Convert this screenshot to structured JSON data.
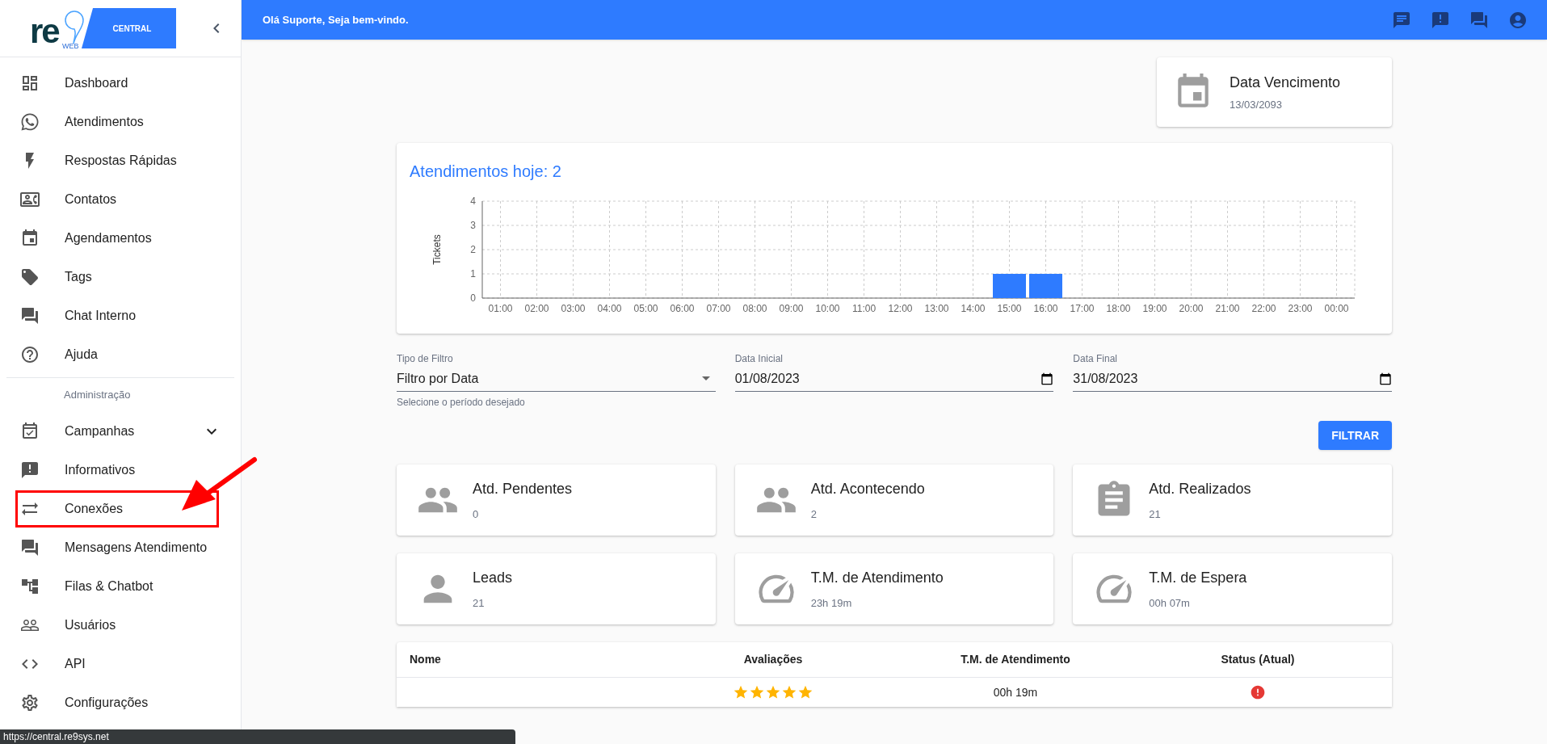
{
  "logo": {
    "text": "re",
    "sub": "WEB",
    "badge": "CENTRAL"
  },
  "sidebar": {
    "items": [
      {
        "kind": "link",
        "label": "Dashboard",
        "highlighted": false
      },
      {
        "kind": "link",
        "label": "Atendimentos",
        "highlighted": false
      },
      {
        "kind": "link",
        "label": "Respostas Rápidas",
        "highlighted": false
      },
      {
        "kind": "link",
        "label": "Contatos",
        "highlighted": false
      },
      {
        "kind": "link",
        "label": "Agendamentos",
        "highlighted": false
      },
      {
        "kind": "link",
        "label": "Tags",
        "highlighted": false
      },
      {
        "kind": "link",
        "label": "Chat Interno",
        "highlighted": false
      },
      {
        "kind": "link",
        "label": "Ajuda",
        "highlighted": false
      },
      {
        "kind": "section",
        "label": "Administração"
      },
      {
        "kind": "group",
        "label": "Campanhas",
        "expanded": false,
        "highlighted": false
      },
      {
        "kind": "link",
        "label": "Informativos",
        "highlighted": false
      },
      {
        "kind": "link",
        "label": "Conexões",
        "highlighted": true
      },
      {
        "kind": "link",
        "label": "Mensagens Atendimento",
        "highlighted": false
      },
      {
        "kind": "link",
        "label": "Filas & Chatbot",
        "highlighted": false
      },
      {
        "kind": "link",
        "label": "Usuários",
        "highlighted": false
      },
      {
        "kind": "link",
        "label": "API",
        "highlighted": false
      },
      {
        "kind": "link",
        "label": "Configurações",
        "highlighted": false
      }
    ]
  },
  "top_bar": {
    "greeting": "Olá Suporte, Seja bem-vindo."
  },
  "due_card": {
    "title": "Data Vencimento",
    "value": "13/03/2093"
  },
  "chart_card": {
    "title": "Atendimentos hoje: 2",
    "chart_data": {
      "type": "bar",
      "ylabel": "Tickets",
      "categories": [
        "01:00",
        "02:00",
        "03:00",
        "04:00",
        "05:00",
        "06:00",
        "07:00",
        "08:00",
        "09:00",
        "10:00",
        "11:00",
        "12:00",
        "13:00",
        "14:00",
        "15:00",
        "16:00",
        "17:00",
        "18:00",
        "19:00",
        "20:00",
        "21:00",
        "22:00",
        "23:00",
        "00:00"
      ],
      "values": [
        0,
        0,
        0,
        0,
        0,
        0,
        0,
        0,
        0,
        0,
        0,
        0,
        0,
        0,
        1,
        1,
        0,
        0,
        0,
        0,
        0,
        0,
        0,
        0
      ],
      "ylim": [
        0,
        4
      ],
      "yticks": [
        0,
        1,
        2,
        3,
        4
      ],
      "grid": true
    }
  },
  "filters": {
    "type": {
      "label": "Tipo de Filtro",
      "value": "Filtro por Data",
      "helper": "Selecione o período desejado"
    },
    "start": {
      "label": "Data Inicial",
      "value": "01/08/2023"
    },
    "end": {
      "label": "Data Final",
      "value": "31/08/2023"
    },
    "button": "FILTRAR"
  },
  "stats": [
    {
      "title": "Atd. Pendentes",
      "value": "0"
    },
    {
      "title": "Atd. Acontecendo",
      "value": "2"
    },
    {
      "title": "Atd. Realizados",
      "value": "21"
    },
    {
      "title": "Leads",
      "value": "21"
    },
    {
      "title": "T.M. de Atendimento",
      "value": "23h 19m"
    },
    {
      "title": "T.M. de Espera",
      "value": "00h 07m"
    }
  ],
  "table": {
    "columns": [
      "Nome",
      "Avaliações",
      "T.M. de Atendimento",
      "Status (Atual)"
    ],
    "rows": [
      {
        "stars": 5,
        "time": "00h 19m"
      }
    ]
  },
  "status_url": "https://central.re9sys.net"
}
